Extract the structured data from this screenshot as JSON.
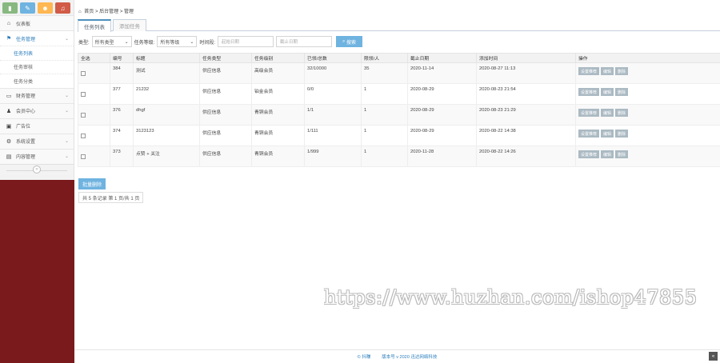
{
  "sidebar": {
    "shortcuts": [
      {
        "icon": "bar-chart-icon",
        "glyph": "▮",
        "color": "#87b87f"
      },
      {
        "icon": "pencil-icon",
        "glyph": "✎",
        "color": "#6fb3e0"
      },
      {
        "icon": "users-icon",
        "glyph": "☻",
        "color": "#ffb752"
      },
      {
        "icon": "bell-icon",
        "glyph": "♫",
        "color": "#d15b47"
      }
    ],
    "dashboard": "仪表板",
    "task_mgmt": "任务管理",
    "sub_items": [
      "任务列表",
      "任务审核",
      "任务分类"
    ],
    "finance": "财务管理",
    "member_center": "会员中心",
    "ads": "广告位",
    "system_settings": "系统设置",
    "content_mgmt": "内容管理"
  },
  "breadcrumb": {
    "home": "首页",
    "sep1": ">",
    "level1": "后台管理",
    "sep2": ">",
    "level2": "管理"
  },
  "tabs": [
    "任务列表",
    "添加任务"
  ],
  "filter": {
    "type_label": "类型:",
    "type_value": "所有类型",
    "level_label": "任务等级:",
    "level_value": "所有等级",
    "time_label": "时间段:",
    "start_placeholder": "起始日期",
    "end_placeholder": "截止日期",
    "search_label": "搜索"
  },
  "table": {
    "headers": [
      "全选",
      "编号",
      "标题",
      "任务类型",
      "任务级别",
      "已领/总数",
      "限领/人",
      "截止日期",
      "添加时间",
      "操作"
    ],
    "rows": [
      {
        "id": "384",
        "title": "测试",
        "type": "供应信息",
        "level": "高级会员",
        "claimed": "32/10000",
        "limit": "35",
        "deadline": "2020-11-14",
        "added": "2020-08-27 11:13"
      },
      {
        "id": "377",
        "title": "21232",
        "type": "供应信息",
        "level": "铂金会员",
        "claimed": "0/0",
        "limit": "1",
        "deadline": "2020-08-29",
        "added": "2020-08-23 21:54"
      },
      {
        "id": "376",
        "title": "dhgf",
        "type": "供应信息",
        "level": "青铜会员",
        "claimed": "1/1",
        "limit": "1",
        "deadline": "2020-08-29",
        "added": "2020-08-23 21:29"
      },
      {
        "id": "374",
        "title": "3123123",
        "type": "供应信息",
        "level": "青铜会员",
        "claimed": "1/111",
        "limit": "1",
        "deadline": "2020-08-29",
        "added": "2020-08-22 14:38"
      },
      {
        "id": "373",
        "title": "点赞 + 关注",
        "type": "供应信息",
        "level": "青铜会员",
        "claimed": "1/999",
        "limit": "1",
        "deadline": "2020-11-28",
        "added": "2020-08-22 14:26"
      }
    ],
    "ops": [
      "设置推荐",
      "编辑",
      "删除"
    ]
  },
  "bulk_delete": "批量删除",
  "pager": "共 5 条记录 第 1 页/共 1 页",
  "watermark": "https://www.huzhan.com/ishop47855",
  "footer": {
    "copyright": "© 抖赚",
    "version": "版本号 v 2020 迅达网络科技"
  },
  "to_top_glyph": "«"
}
